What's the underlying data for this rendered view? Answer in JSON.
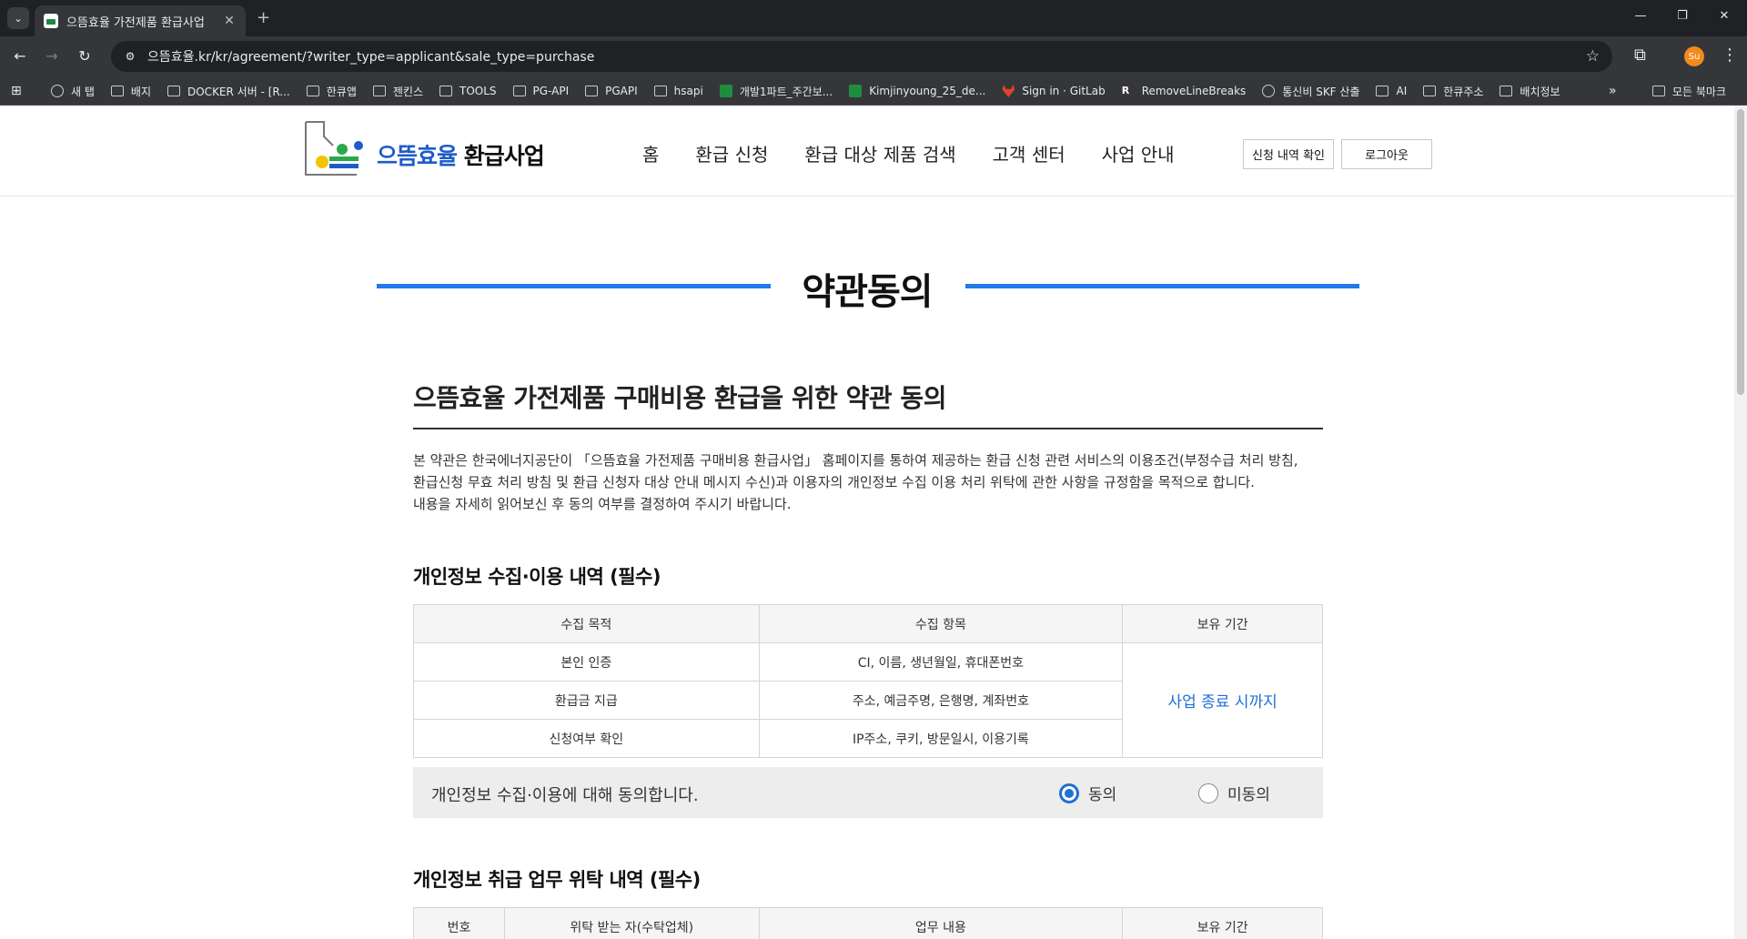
{
  "browser": {
    "tab_title": "으뜸효율 가전제품 환급사업",
    "url": "으뜸효율.kr/kr/agreement/?writer_type=applicant&sale_type=purchase",
    "profile_initial": "Su",
    "bookmarks": [
      {
        "label": "새 탭",
        "icon": "globe-icon"
      },
      {
        "label": "배지",
        "icon": "folder-icon"
      },
      {
        "label": "DOCKER 서버 - [R...",
        "icon": "folder-icon"
      },
      {
        "label": "한큐앱",
        "icon": "folder-icon"
      },
      {
        "label": "젠킨스",
        "icon": "folder-icon"
      },
      {
        "label": "TOOLS",
        "icon": "folder-icon"
      },
      {
        "label": "PG-API",
        "icon": "folder-icon"
      },
      {
        "label": "PGAPI",
        "icon": "folder-icon"
      },
      {
        "label": "hsapi",
        "icon": "folder-icon"
      },
      {
        "label": "개발1파트_주간보...",
        "icon": "sheets-icon"
      },
      {
        "label": "Kimjinyoung_25_de...",
        "icon": "sheets-icon"
      },
      {
        "label": "Sign in · GitLab",
        "icon": "gitlab-icon"
      },
      {
        "label": "RemoveLineBreaks",
        "icon": "r-icon"
      },
      {
        "label": "통신비 SKF 산출",
        "icon": "globe-icon"
      },
      {
        "label": "AI",
        "icon": "folder-icon"
      },
      {
        "label": "한큐주소",
        "icon": "folder-icon"
      },
      {
        "label": "배치정보",
        "icon": "folder-icon"
      }
    ],
    "all_bookmarks": "모든 북마크"
  },
  "header": {
    "brand_highlight": "으뜸효율",
    "brand_rest": " 환급사업",
    "nav": [
      "홈",
      "환급 신청",
      "환급 대상 제품 검색",
      "고객 센터",
      "사업 안내"
    ],
    "btn_history": "신청 내역 확인",
    "btn_logout": "로그아웃"
  },
  "page": {
    "title": "약관동의",
    "subtitle": "으뜸효율 가전제품 구매비용 환급을 위한 약관 동의",
    "intro": [
      "본 약관은 한국에너지공단이 「으뜸효율 가전제품 구매비용 환급사업」 홈페이지를 통하여 제공하는 환급 신청 관련 서비스의 이용조건(부정수급 처리 방침,",
      "환급신청 무효 처리 방침 및 환급 신청자 대상 안내 메시지 수신)과 이용자의 개인정보 수집 이용 처리 위탁에 관한 사항을 규정함을 목적으로 합니다.",
      "내용을 자세히 읽어보신 후 동의 여부를 결정하여 주시기 바랍니다."
    ]
  },
  "privacy": {
    "section_title": "개인정보 수집·이용 내역 (필수)",
    "headers": [
      "수집 목적",
      "수집 항목",
      "보유 기간"
    ],
    "rows": [
      {
        "purpose": "본인 인증",
        "items": "CI, 이름, 생년월일, 휴대폰번호"
      },
      {
        "purpose": "환급금 지급",
        "items": "주소, 예금주명, 은행명, 계좌번호"
      },
      {
        "purpose": "신청여부 확인",
        "items": "IP주소, 쿠키, 방문일시, 이용기록"
      }
    ],
    "retention": "사업 종료 시까지",
    "agree_text": "개인정보 수집·이용에 대해 동의합니다.",
    "agree_label": "동의",
    "disagree_label": "미동의",
    "selected": "agree"
  },
  "outsourcing": {
    "section_title": "개인정보 취급 업무 위탁 내역 (필수)",
    "headers": [
      "번호",
      "위탁 받는 자(수탁업체)",
      "업무 내용",
      "보유 기간"
    ]
  },
  "colors": {
    "accent": "#1f7bea",
    "brand_blue": "#1f5cc7",
    "link_blue": "#1f6fd6"
  }
}
